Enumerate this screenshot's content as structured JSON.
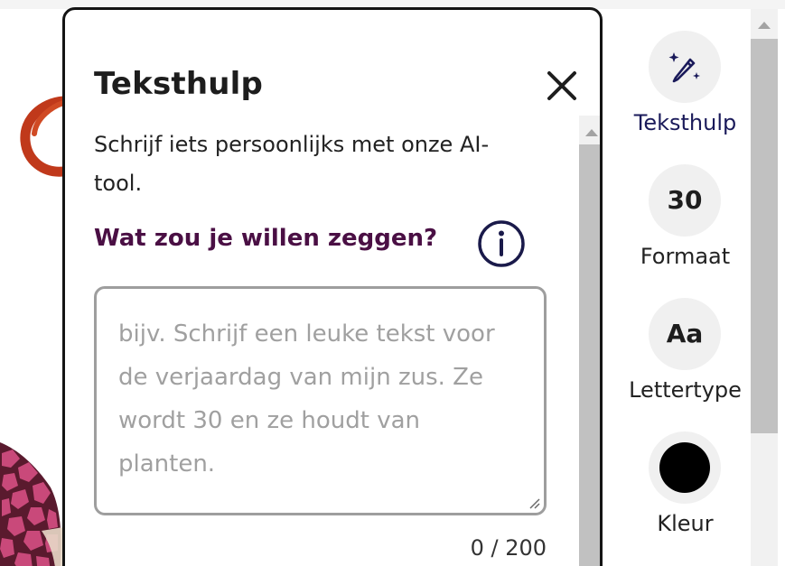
{
  "panel": {
    "title": "Teksthulp",
    "description": "Schrijf iets persoonlijks met onze AI-tool.",
    "question": "Wat zou je willen zeggen?",
    "textarea": {
      "value": "",
      "placeholder": "bijv. Schrijf een leuke tekst voor de verjaardag van mijn zus. Ze wordt 30 en ze houdt van planten."
    },
    "counter": "0 / 200",
    "close_icon": "close-icon",
    "info_icon": "info-icon"
  },
  "toolbar": {
    "items": [
      {
        "label": "Teksthulp",
        "icon": "magic-pencil-icon",
        "active": true
      },
      {
        "label": "Formaat",
        "value": "30"
      },
      {
        "label": "Lettertype",
        "value": "Aa"
      },
      {
        "label": "Kleur",
        "color": "#000000"
      }
    ]
  },
  "colors": {
    "accent_question": "#4a0f44",
    "active_tool": "#1a1a5a",
    "panel_border": "#141414",
    "textarea_border": "#9e9e9e"
  }
}
